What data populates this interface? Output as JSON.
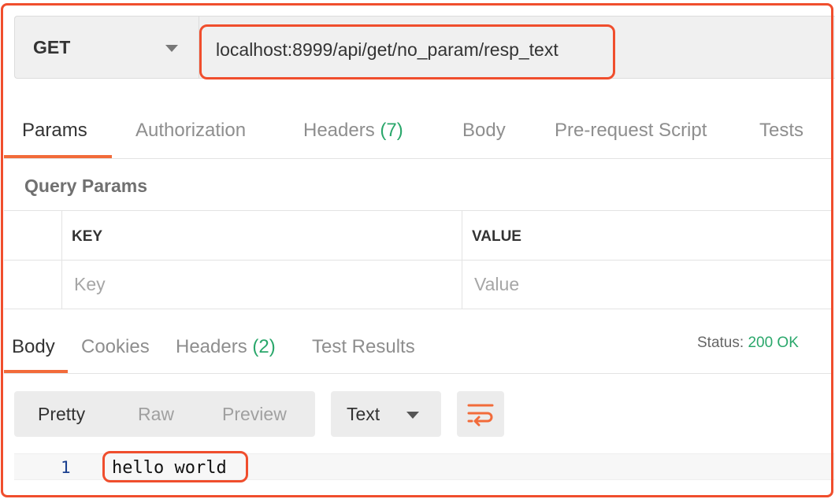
{
  "request": {
    "method": "GET",
    "url": "localhost:8999/api/get/no_param/resp_text"
  },
  "request_tabs": {
    "params": "Params",
    "authorization": "Authorization",
    "headers": "Headers",
    "headers_count": "(7)",
    "body": "Body",
    "prerequest": "Pre-request Script",
    "tests": "Tests"
  },
  "query_params": {
    "title": "Query Params",
    "key_header": "KEY",
    "value_header": "VALUE",
    "key_placeholder": "Key",
    "value_placeholder": "Value"
  },
  "response_tabs": {
    "body": "Body",
    "cookies": "Cookies",
    "headers": "Headers",
    "headers_count": "(2)",
    "test_results": "Test Results"
  },
  "status": {
    "label": "Status:",
    "value": "200 OK",
    "color": "#2aa76b"
  },
  "view_modes": {
    "pretty": "Pretty",
    "raw": "Raw",
    "preview": "Preview"
  },
  "format": {
    "selected": "Text"
  },
  "icons": {
    "method_dropdown": "chevron-down-icon",
    "format_dropdown": "chevron-down-icon",
    "wrap": "wrap-lines-icon"
  },
  "response_body": {
    "line_number": "1",
    "text": "hello world"
  },
  "colors": {
    "accent": "#f26b3a",
    "highlight": "#f04e2d"
  }
}
